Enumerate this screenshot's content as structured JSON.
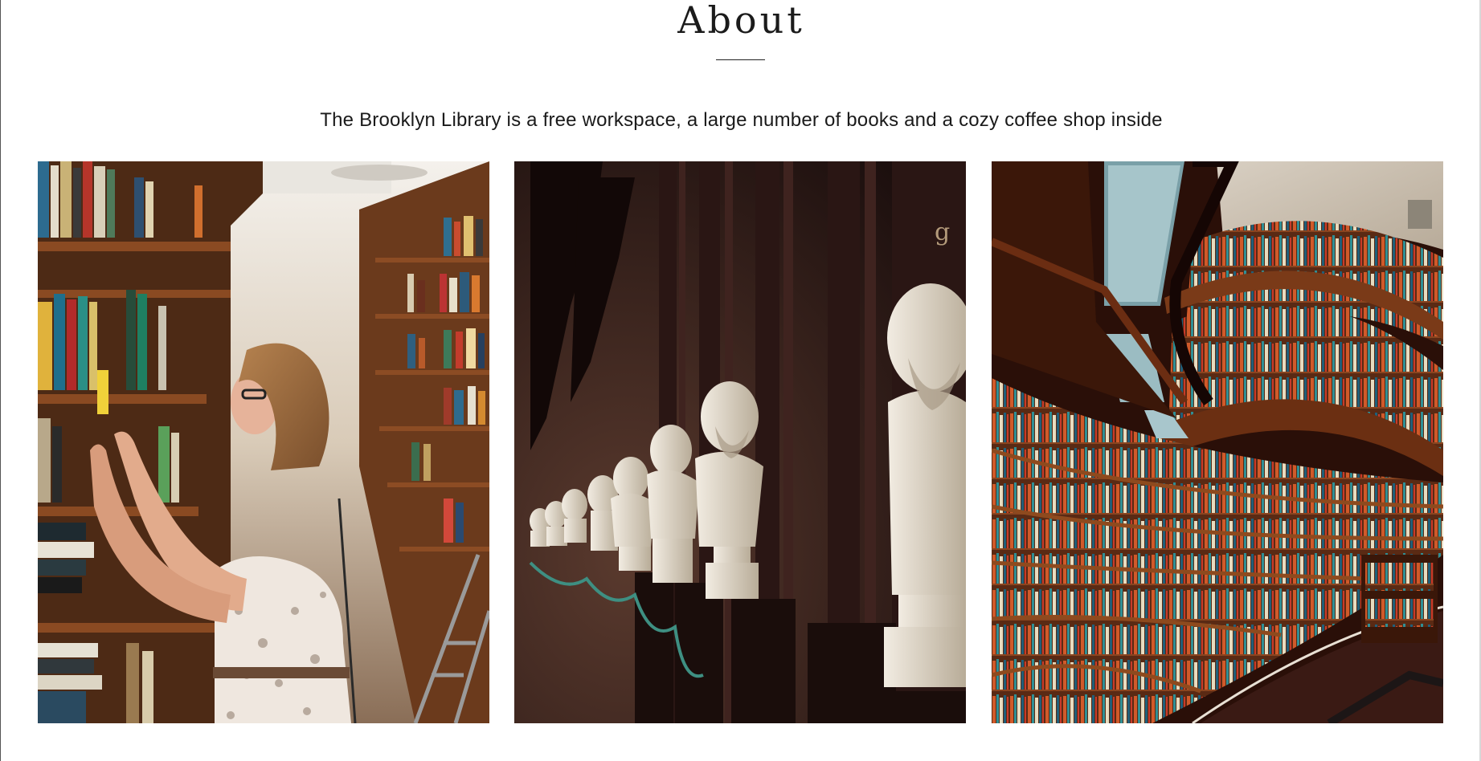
{
  "about": {
    "title": "About",
    "description": "The Brooklyn Library is a free workspace, a large number of books and a cozy coffee shop inside"
  },
  "gallery": {
    "images": [
      {
        "subject": "woman-browsing-bookshelves"
      },
      {
        "subject": "marble-busts-in-library-hall"
      },
      {
        "subject": "curved-library-bookshelves"
      }
    ],
    "bust_hall_letter": "g"
  },
  "colors": {
    "text": "#1a1a1a",
    "shelf_wood": "#7a3f1d",
    "dark_wood": "#2a1512",
    "marble": "#d9d0c0"
  }
}
